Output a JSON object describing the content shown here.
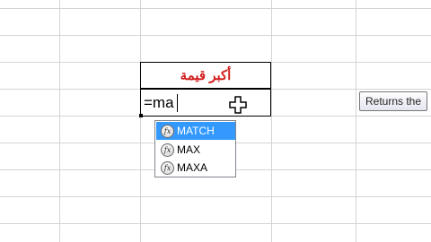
{
  "title_cell": {
    "text": "أكبر قيمة"
  },
  "edit_cell": {
    "value": "=ma"
  },
  "tooltip": {
    "text": "Returns the"
  },
  "autocomplete": {
    "items": [
      {
        "label": "MATCH",
        "selected": true
      },
      {
        "label": "MAX",
        "selected": false
      },
      {
        "label": "MAXA",
        "selected": false
      }
    ]
  },
  "colors": {
    "title": "#d21f1f",
    "selection": "#3399ff",
    "gridline": "#d4d4d4"
  }
}
